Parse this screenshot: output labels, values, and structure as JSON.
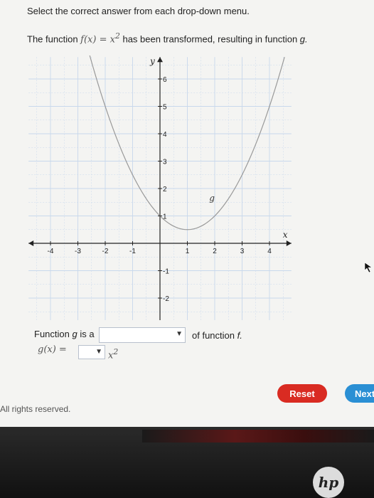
{
  "instruction": "Select the correct answer from each drop-down menu.",
  "prompt": {
    "lead": "The function",
    "f_expr": "f(x)  =  x",
    "f_exp": "2",
    "tail": "has been transformed, resulting in function",
    "g_name": "g."
  },
  "graph": {
    "x_axis_label": "x",
    "y_axis_label": "y",
    "x_ticks": [
      "-4",
      "-3",
      "-2",
      "-1",
      "1",
      "2",
      "3",
      "4"
    ],
    "y_ticks": [
      "-2",
      "-1",
      "1",
      "2",
      "3",
      "4",
      "5",
      "6"
    ],
    "curve_label": "g"
  },
  "answer": {
    "row1_lead": "Function",
    "row1_g": "g",
    "row1_is_a": "is a",
    "row1_tail": "of function",
    "row1_f": "f.",
    "row2_lead": "g(x)  =",
    "row2_exp": "x",
    "row2_exp_power": "2",
    "dropdown1_value": "",
    "dropdown2_value": ""
  },
  "buttons": {
    "reset": "Reset",
    "next": "Next"
  },
  "footer": "All rights reserved.",
  "bezel": {
    "logo": "hp"
  },
  "colors": {
    "reset": "#d92b22",
    "next": "#2a8fd4",
    "grid": "#c8d8ec"
  }
}
